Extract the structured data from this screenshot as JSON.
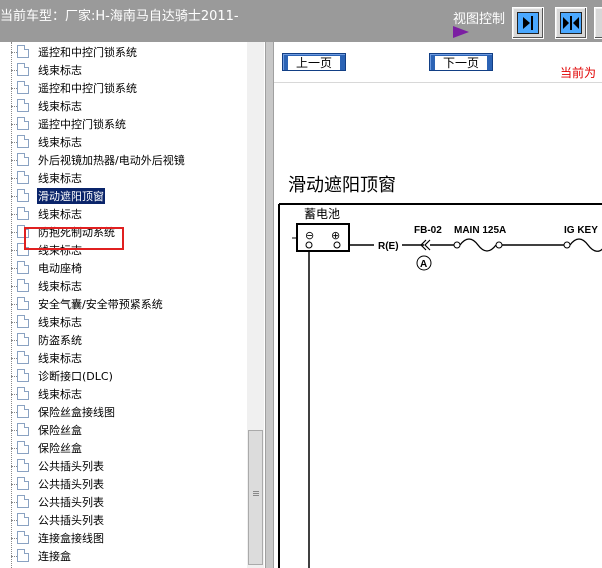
{
  "header": {
    "vehicle_prefix": "当前车型：厂家:H-海南马自达骑士2011-",
    "view_control_label": "视图控制"
  },
  "tree": {
    "items": [
      "遥控和中控门锁系统",
      "线束标志",
      "遥控和中控门锁系统",
      "线束标志",
      "遥控中控门锁系统",
      "线束标志",
      "外后视镜加热器/电动外后视镜",
      "线束标志",
      "滑动遮阳顶窗",
      "线束标志",
      "防抱死制动系统",
      "线束标志",
      "电动座椅",
      "线束标志",
      "安全气囊/安全带预紧系统",
      "线束标志",
      "防盗系统",
      "线束标志",
      "诊断接口(DLC)",
      "线束标志",
      "保险丝盒接线图",
      "保险丝盒",
      "保险丝盒",
      "公共插头列表",
      "公共插头列表",
      "公共插头列表",
      "公共插头列表",
      "连接盒接线图",
      "连接盒"
    ],
    "selected_index": 8
  },
  "nav": {
    "prev_label": "上一页",
    "next_label": "下一页",
    "current_label": "当前为"
  },
  "diagram": {
    "title": "滑动遮阳顶窗",
    "battery_label": "蓄电池",
    "minus_symbol": "⊖",
    "plus_symbol": "⊕",
    "wire_label": "R(E)",
    "connector_label": "FB-02",
    "connector_marker": "A",
    "fuse_main_label": "MAIN 125A",
    "ig_key_label": "IG KEY"
  },
  "colors": {
    "topbar": "#9a9a9a",
    "selection": "#0a246a",
    "nav_button": "#2b63b5",
    "highlight_box": "#e02020",
    "current_label": "#e00000"
  },
  "icons": {
    "view_control_arrow": "purple-triangle-right",
    "view_buttons": [
      "arrow-to-right-bar-icon",
      "arrows-inward-icon"
    ],
    "tree_item": "document-icon"
  }
}
